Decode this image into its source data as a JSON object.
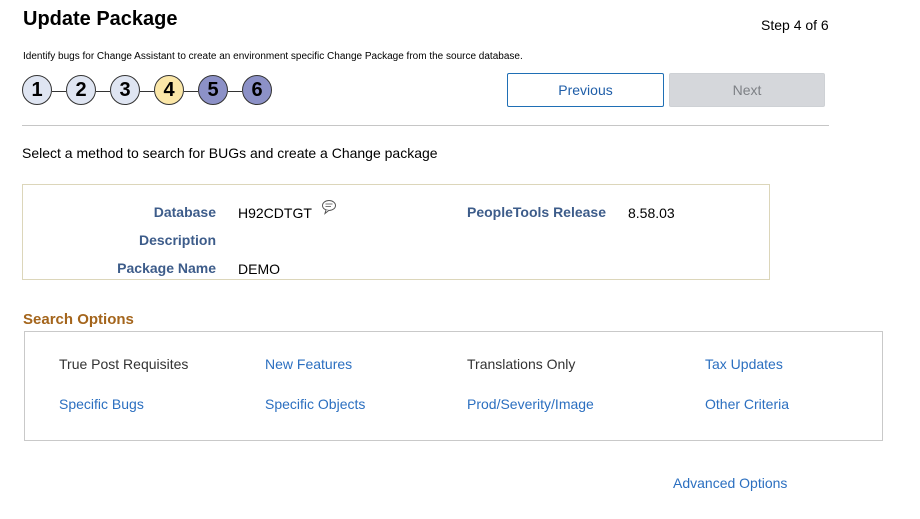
{
  "header": {
    "title": "Update Package",
    "step_text": "Step 4 of 6",
    "instructions": "Identify bugs for Change Assistant to create an environment specific Change Package from the source database."
  },
  "steps": [
    "1",
    "2",
    "3",
    "4",
    "5",
    "6"
  ],
  "nav": {
    "previous_label": "Previous",
    "next_label": "Next"
  },
  "method_prompt": "Select a method to search for BUGs and create a Change package",
  "details": {
    "database_label": "Database",
    "database_value": "H92CDTGT",
    "description_label": "Description",
    "package_name_label": "Package Name",
    "package_name_value": "DEMO",
    "tools_release_label": "PeopleTools Release",
    "tools_release_value": "8.58.03"
  },
  "search_options": {
    "title": "Search Options",
    "row1": [
      "True Post Requisites",
      "New Features",
      "Translations Only",
      "Tax Updates"
    ],
    "row2": [
      "Specific Bugs",
      "Specific Objects",
      "Prod/Severity/Image",
      "Other Criteria"
    ]
  },
  "advanced_options_label": "Advanced Options",
  "colors": {
    "link": "#2b6fc0",
    "label": "#3d5c8a",
    "section_title": "#a4651c",
    "step_done": "#dfe5f2",
    "step_current": "#fbe7a8",
    "step_future": "#8c91c7"
  }
}
